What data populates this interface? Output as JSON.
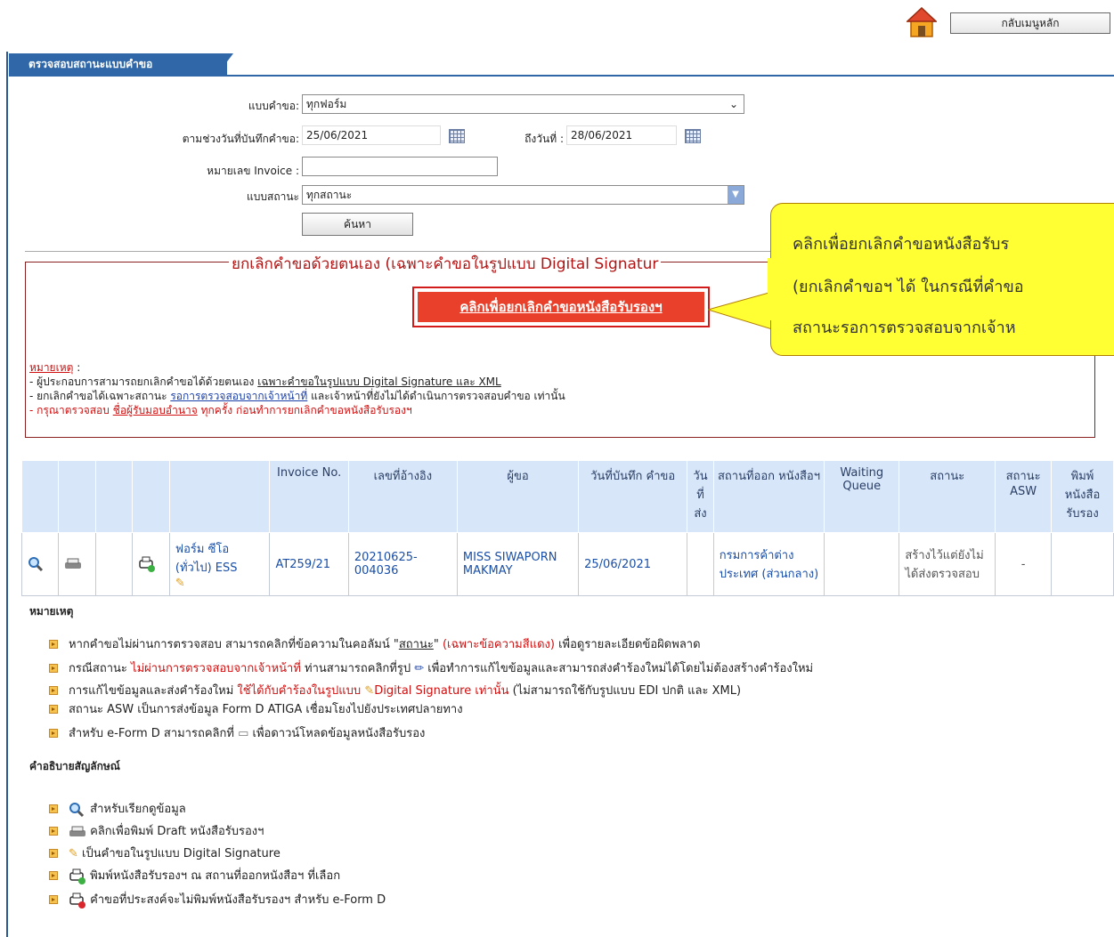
{
  "header": {
    "home_button": "กลับเมนูหลัก"
  },
  "tab": {
    "title": "ตรวจสอบสถานะแบบคำขอ"
  },
  "form": {
    "form_type_label": "แบบคำขอ:",
    "form_type_value": "ทุกฟอร์ม",
    "date_from_label": "ตามช่วงวันที่บันทึกคำขอ:",
    "date_from_value": "25/06/2021",
    "date_to_label": "ถึงวันที่ :",
    "date_to_value": "28/06/2021",
    "invoice_label": "หมายเลข Invoice :",
    "invoice_value": "",
    "status_label": "แบบสถานะ",
    "status_value": "ทุกสถานะ",
    "search_button": "ค้นหา"
  },
  "cancel_section": {
    "legend": "ยกเลิกคำขอด้วยตนเอง (เฉพาะคำขอในรูปแบบ Digital Signatur",
    "button": "คลิกเพื่อยกเลิกคำขอหนังสือรับรองฯ",
    "note_label": "หมายเหตุ",
    "note_colon": " :",
    "note1_a": "- ผู้ประกอบการสามารถยกเลิกคำขอได้ด้วยตนเอง ",
    "note1_b": "เฉพาะคำขอในรูปแบบ Digital Signature และ XML",
    "note2_a": "- ยกเลิกคำขอได้เฉพาะสถานะ ",
    "note2_b": "รอการตรวจสอบจากเจ้าหน้าที่",
    "note2_c": " และเจ้าหน้าที่ยังไม่ได้ดำเนินการตรวจสอบคำขอ เท่านั้น",
    "note3_a": "- กรุณาตรวจสอบ ",
    "note3_b": "ชื่อผู้รับมอบอำนาจ",
    "note3_c": " ทุกครั้ง ก่อนทำการยกเลิกคำขอหนังสือรับรองฯ"
  },
  "callout": {
    "line1": "คลิกเพื่อยกเลิกคำขอหนังสือรับร",
    "line2": "(ยกเลิกคำขอฯ ได้ ในกรณีที่คำขอ",
    "line3": "สถานะรอการตรวจสอบจากเจ้าห"
  },
  "table": {
    "headers": [
      "Invoice No.",
      "เลขที่อ้างอิง",
      "ผู้ขอ",
      "วันที่บันทึก คำขอ",
      "วัน ที่ ส่ง",
      "สถานที่ออก หนังสือฯ",
      "Waiting Queue",
      "สถานะ",
      "สถานะ ASW",
      "พิมพ์ หนังสือ รับรอง"
    ],
    "row": {
      "form": "ฟอร์ม ซีโอ (ทั่วไป) ESS",
      "invoice": "AT259/21",
      "ref": "20210625-004036",
      "applicant": "MISS SIWAPORN MAKMAY",
      "date": "25/06/2021",
      "send_date": "",
      "office": "กรมการค้าต่างประเทศ (ส่วนกลาง)",
      "queue": "",
      "status": "สร้างไว้แต่ยังไม่ได้ส่งตรวจสอบ",
      "asw": "-",
      "print": ""
    }
  },
  "remarks": {
    "title": "หมายเหตุ",
    "r1_a": "หากคำขอไม่ผ่านการตรวจสอบ สามารถคลิกที่ข้อความในคอลัมน์ \"",
    "r1_b": "สถานะ",
    "r1_c": "\" ",
    "r1_d": "(เฉพาะข้อความสีแดง)",
    "r1_e": " เพื่อดูรายละเอียดข้อผิดพลาด",
    "r2_a": "กรณีสถานะ ",
    "r2_b": "ไม่ผ่านการตรวจสอบจากเจ้าหน้าที่",
    "r2_c": " ท่านสามารถคลิกที่รูป ",
    "r2_d": " เพื่อทำการแก้ไขข้อมูลและสามารถส่งคำร้องใหม่ได้โดยไม่ต้องสร้างคำร้องใหม่",
    "r3_a": "การแก้ไขข้อมูลและส่งคำร้องใหม่ ",
    "r3_b": "ใช้ได้กับคำร้องในรูปแบบ ",
    "r3_c": "Digital Signature เท่านั้น",
    "r3_d": " (ไม่สามารถใช้กับรูปแบบ EDI ปกติ และ XML)",
    "r4": "สถานะ ASW เป็นการส่งข้อมูล Form D ATIGA เชื่อมโยงไปยังประเทศปลายทาง",
    "r5_a": "สำหรับ e-Form D สามารถคลิกที่ ",
    "r5_b": " เพื่อดาวน์โหลดข้อมูลหนังสือรับรอง"
  },
  "legend": {
    "title": "คำอธิบายสัญลักษณ์",
    "l1": "สำหรับเรียกดูข้อมูล",
    "l2": "คลิกเพื่อพิมพ์ Draft หนังสือรับรองฯ",
    "l3": "เป็นคำขอในรูปแบบ Digital Signature",
    "l4": "พิมพ์หนังสือรับรองฯ ณ สถานที่ออกหนังสือฯ ที่เลือก",
    "l5": "คำขอที่ประสงค์จะไม่พิมพ์หนังสือรับรองฯ สำหรับ e-Form D"
  }
}
